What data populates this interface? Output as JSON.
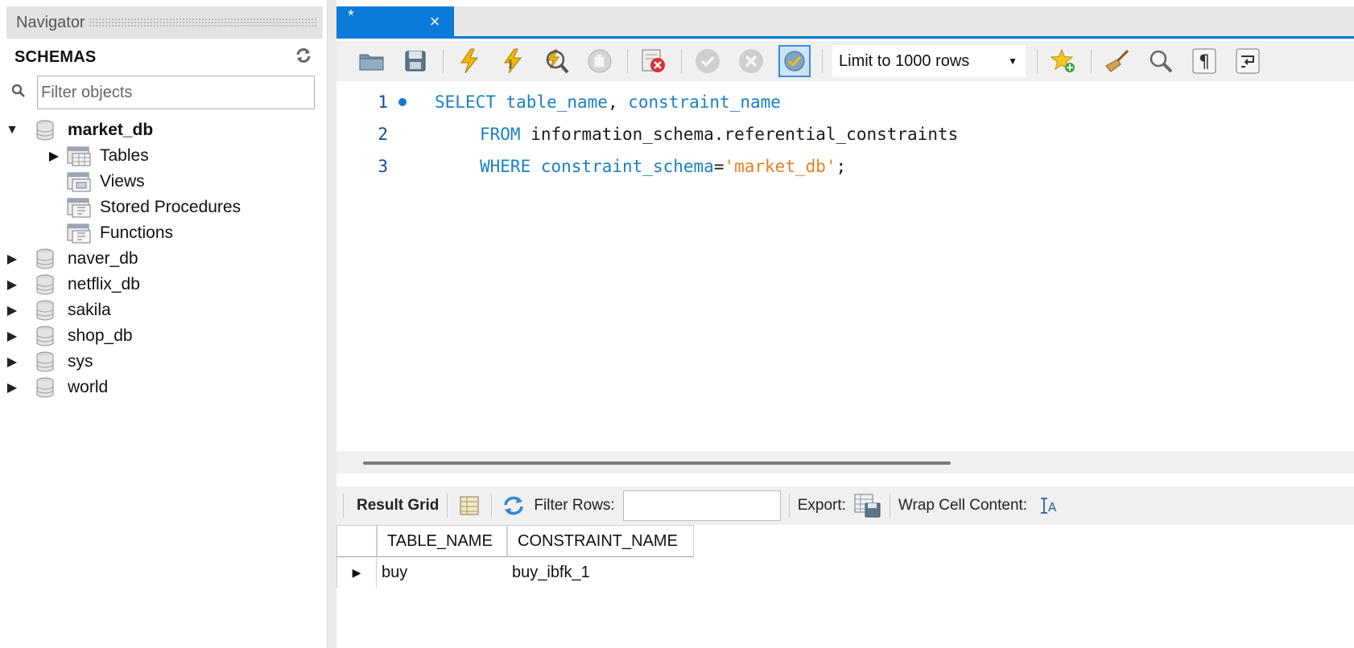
{
  "navigator": {
    "title": "Navigator",
    "schemas_label": "SCHEMAS",
    "filter_placeholder": "Filter objects",
    "schemas": [
      {
        "name": "market_db",
        "expanded": true,
        "children": [
          "Tables",
          "Views",
          "Stored Procedures",
          "Functions"
        ]
      },
      {
        "name": "naver_db"
      },
      {
        "name": "netflix_db"
      },
      {
        "name": "sakila"
      },
      {
        "name": "shop_db"
      },
      {
        "name": "sys"
      },
      {
        "name": "world"
      }
    ]
  },
  "editor": {
    "tab_title": "*",
    "limit_rows": "Limit to 1000 rows",
    "line_numbers": [
      "1",
      "2",
      "3"
    ],
    "sql": {
      "line1": {
        "kw": "SELECT",
        "a": "table_name",
        "sep": ", ",
        "b": "constraint_name"
      },
      "line2": {
        "kw": "FROM",
        "rest": "information_schema.referential_constraints"
      },
      "line3": {
        "kw": "WHERE",
        "col": "constraint_schema",
        "eq": "=",
        "str": "'market_db'",
        "end": ";"
      }
    }
  },
  "results": {
    "result_grid_label": "Result Grid",
    "filter_rows_label": "Filter Rows:",
    "filter_rows_value": "",
    "export_label": "Export:",
    "wrap_label": "Wrap Cell Content:",
    "columns": [
      "TABLE_NAME",
      "CONSTRAINT_NAME"
    ],
    "rows": [
      [
        "buy",
        "buy_ibfk_1"
      ]
    ]
  },
  "colors": {
    "accent": "#0a7bd8",
    "keyword": "#1a80c4",
    "string": "#e67e22"
  }
}
